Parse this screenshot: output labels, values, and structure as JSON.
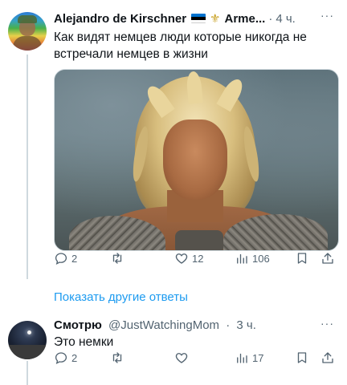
{
  "tweet1": {
    "author_name": "Alejandro de Kirschner",
    "author_name_2": "Arme...",
    "time": "4 ч.",
    "text": "Как видят немцев люди которые никогда не встречали немцев в жизни",
    "replies": "2",
    "retweets": "",
    "likes": "12",
    "views": "106"
  },
  "show_more_label": "Показать другие ответы",
  "tweet2": {
    "author_name": "Смотрю",
    "handle": "@JustWatchingMom",
    "time": "3 ч.",
    "text": "Это немки",
    "replies": "2",
    "retweets": "",
    "likes": "",
    "views": "17"
  },
  "icons": {
    "more": "more-dots-icon",
    "reply": "reply-icon",
    "retweet": "retweet-icon",
    "like": "heart-icon",
    "views": "views-icon",
    "bookmark": "bookmark-icon",
    "share": "share-icon"
  },
  "colors": {
    "accent": "#1d9bf0",
    "muted": "#536471",
    "text": "#0f1419"
  }
}
